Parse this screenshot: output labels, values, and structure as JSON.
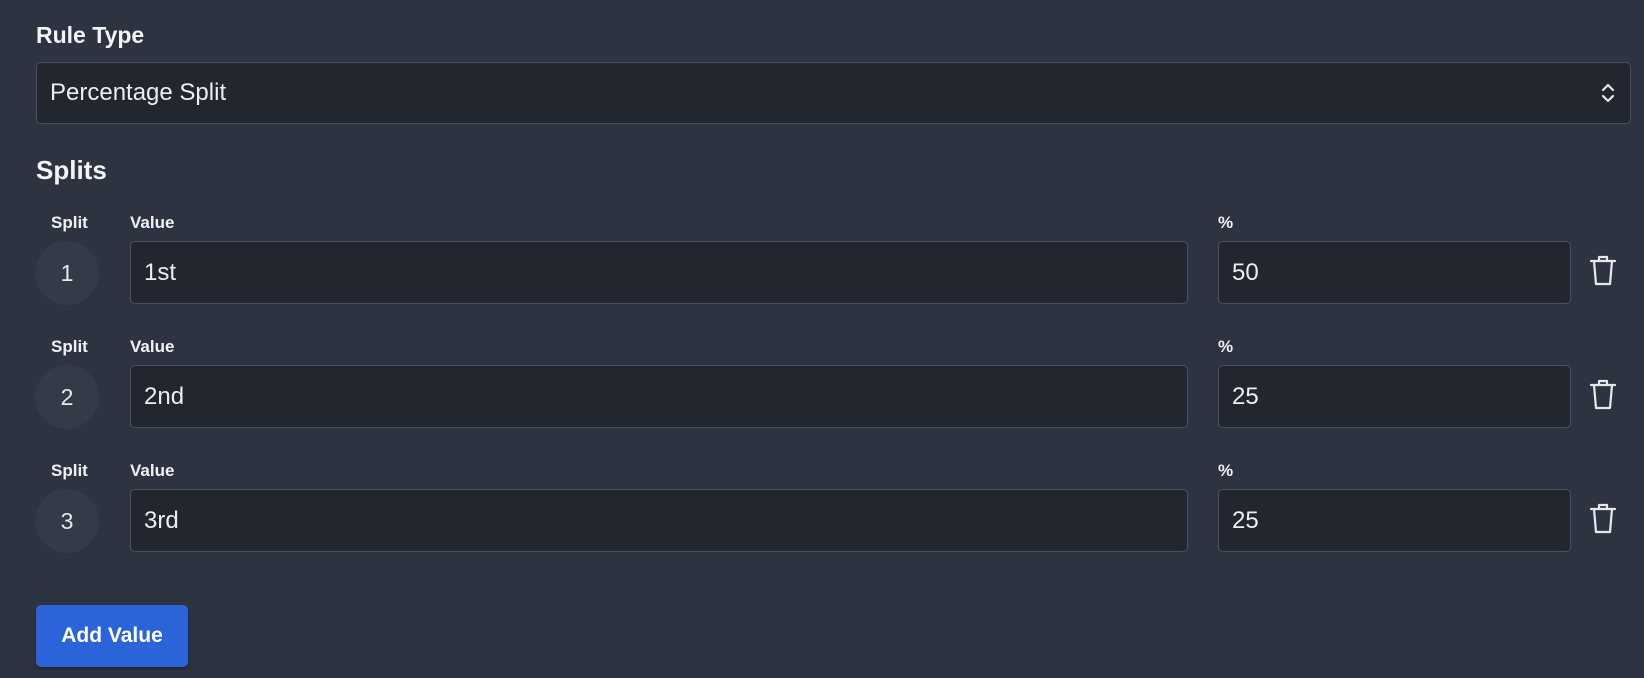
{
  "rule_type": {
    "label": "Rule Type",
    "selected": "Percentage Split"
  },
  "splits": {
    "title": "Splits",
    "column_labels": {
      "split": "Split",
      "value": "Value",
      "percent": "%"
    },
    "rows": [
      {
        "number": "1",
        "value": "1st",
        "percent": "50"
      },
      {
        "number": "2",
        "value": "2nd",
        "percent": "25"
      },
      {
        "number": "3",
        "value": "3rd",
        "percent": "25"
      }
    ]
  },
  "actions": {
    "add_value_label": "Add Value"
  },
  "icons": {
    "select": "chevron-up-down-icon",
    "delete": "trash-icon"
  },
  "colors": {
    "background": "#2d3340",
    "input_background": "#22262f",
    "input_border": "#4a5060",
    "primary_button": "#2b64d8"
  }
}
